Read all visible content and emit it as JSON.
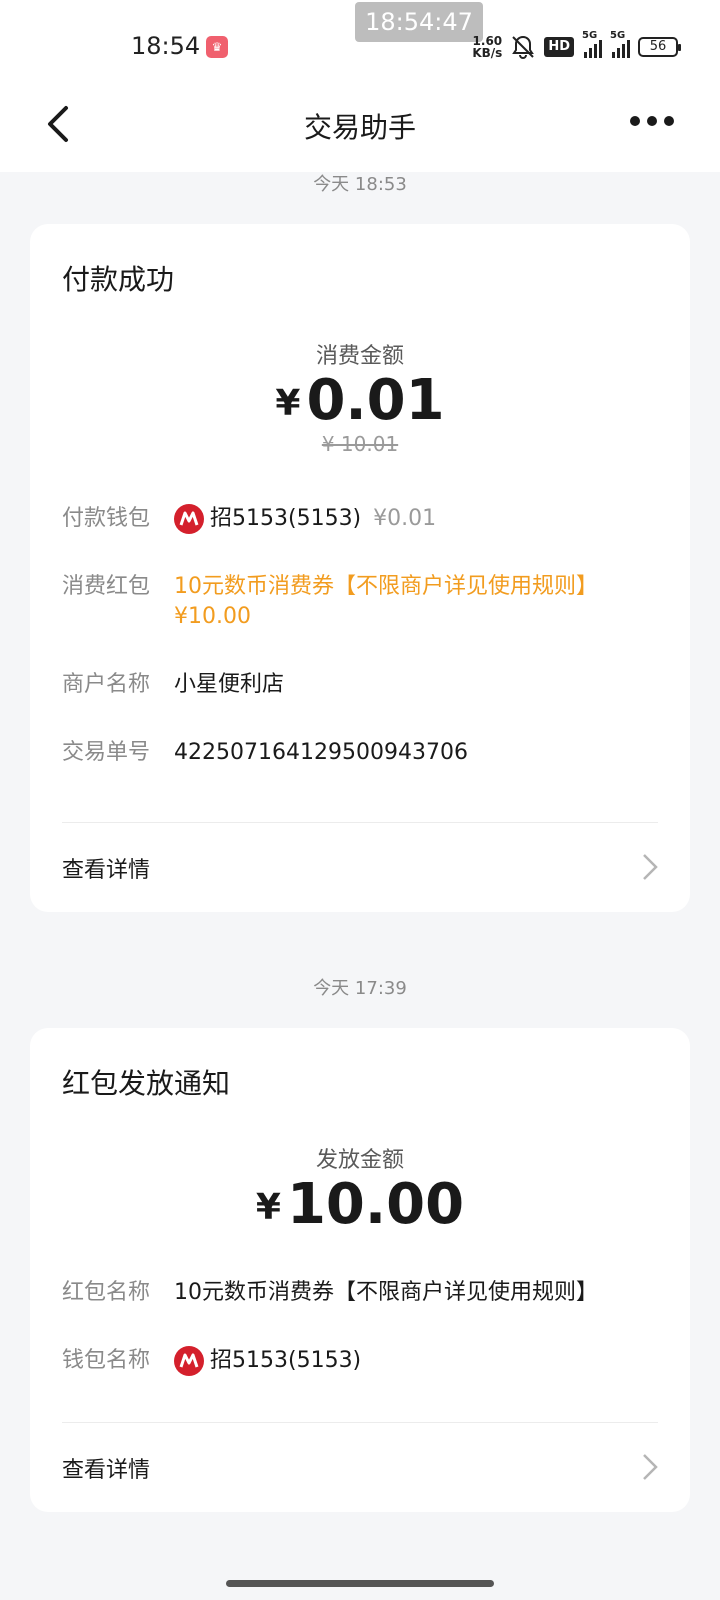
{
  "status_bar": {
    "time": "18:54",
    "overlay_time": "18:54:47",
    "net_speed_value": "1.60",
    "net_speed_unit": "KB/s",
    "hd_label": "HD",
    "signal1_label": "5G",
    "signal2_label": "5G",
    "battery": "56"
  },
  "nav": {
    "title": "交易助手"
  },
  "messages": [
    {
      "timestamp": "今天 18:53",
      "title": "付款成功",
      "amount_label": "消费金额",
      "currency": "¥",
      "amount": "0.01",
      "original_amount": "¥ 10.01",
      "wallet_key": "付款钱包",
      "wallet_name": "招5153(5153)",
      "wallet_amount": "¥0.01",
      "coupon_key": "消费红包",
      "coupon_name": "10元数币消费券【不限商户详见使用规则】",
      "coupon_amount": "¥10.00",
      "merchant_key": "商户名称",
      "merchant_name": "小星便利店",
      "order_key": "交易单号",
      "order_no": "422507164129500943706",
      "detail_link": "查看详情"
    },
    {
      "timestamp": "今天 17:39",
      "title": "红包发放通知",
      "amount_label": "发放金额",
      "currency": "¥",
      "amount": "10.00",
      "packet_key": "红包名称",
      "packet_name": "10元数币消费券【不限商户详见使用规则】",
      "wallet_key": "钱包名称",
      "wallet_name": "招5153(5153)",
      "detail_link": "查看详情"
    }
  ],
  "colors": {
    "coupon_orange": "#f29c1f",
    "bank_red": "#d4202c",
    "background": "#f5f6f8"
  },
  "icons": [
    "back-arrow-icon",
    "more-dots-icon",
    "bank-logo-icon",
    "chevron-right-icon"
  ]
}
